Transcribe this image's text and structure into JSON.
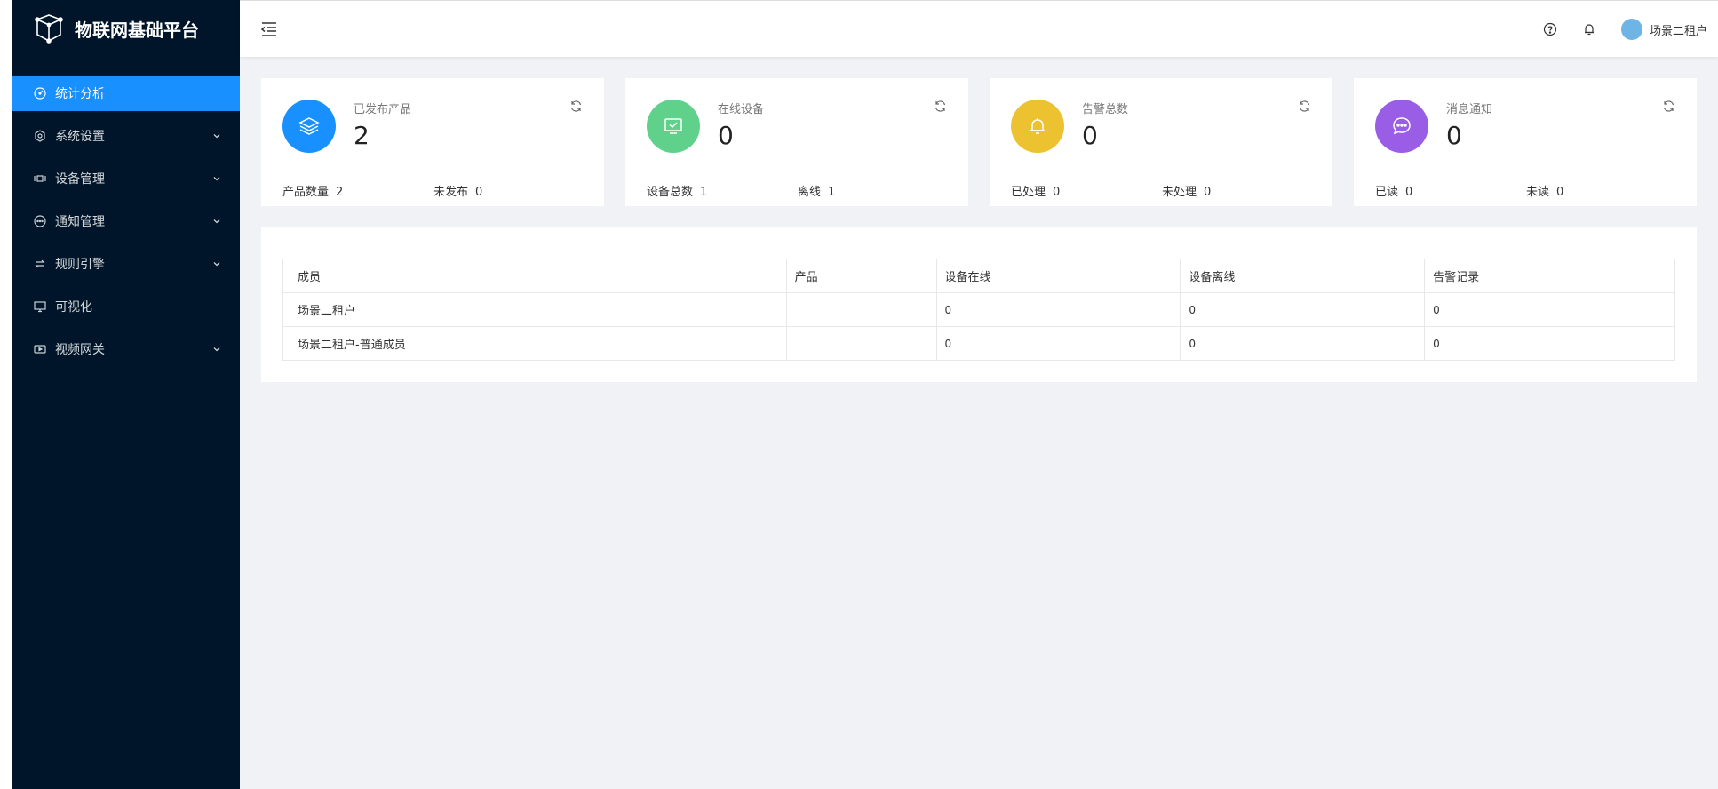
{
  "app": {
    "title": "物联网基础平台"
  },
  "sidebar": {
    "items": [
      {
        "label": "统计分析",
        "icon": "dashboard-icon",
        "active": true,
        "has_children": false
      },
      {
        "label": "系统设置",
        "icon": "gear-icon",
        "active": false,
        "has_children": true
      },
      {
        "label": "设备管理",
        "icon": "device-icon",
        "active": false,
        "has_children": true
      },
      {
        "label": "通知管理",
        "icon": "message-icon",
        "active": false,
        "has_children": true
      },
      {
        "label": "规则引擎",
        "icon": "swap-icon",
        "active": false,
        "has_children": true
      },
      {
        "label": "可视化",
        "icon": "monitor-icon",
        "active": false,
        "has_children": false
      },
      {
        "label": "视频网关",
        "icon": "video-icon",
        "active": false,
        "has_children": true
      }
    ]
  },
  "header": {
    "help_icon": "question-circle-icon",
    "bell_icon": "bell-icon",
    "user_name": "场景二租户"
  },
  "cards": [
    {
      "title": "已发布产品",
      "value": "2",
      "icon": "layers-icon",
      "color": "#1890ff",
      "sub": [
        {
          "label": "产品数量",
          "value": "2"
        },
        {
          "label": "未发布",
          "value": "0"
        }
      ]
    },
    {
      "title": "在线设备",
      "value": "0",
      "icon": "monitor-check-icon",
      "color": "#5fd18a",
      "sub": [
        {
          "label": "设备总数",
          "value": "1"
        },
        {
          "label": "离线",
          "value": "1"
        }
      ]
    },
    {
      "title": "告警总数",
      "value": "0",
      "icon": "alarm-bell-icon",
      "color": "#ecc231",
      "sub": [
        {
          "label": "已处理",
          "value": "0"
        },
        {
          "label": "未处理",
          "value": "0"
        }
      ]
    },
    {
      "title": "消息通知",
      "value": "0",
      "icon": "chat-bubble-icon",
      "color": "#9a5ee6",
      "sub": [
        {
          "label": "已读",
          "value": "0"
        },
        {
          "label": "未读",
          "value": "0"
        }
      ]
    }
  ],
  "table": {
    "columns": [
      "成员",
      "产品",
      "设备在线",
      "设备离线",
      "告警记录"
    ],
    "rows": [
      [
        "场景二租户",
        "",
        "0",
        "0",
        "0"
      ],
      [
        "场景二租户-普通成员",
        "",
        "0",
        "0",
        "0"
      ]
    ]
  }
}
